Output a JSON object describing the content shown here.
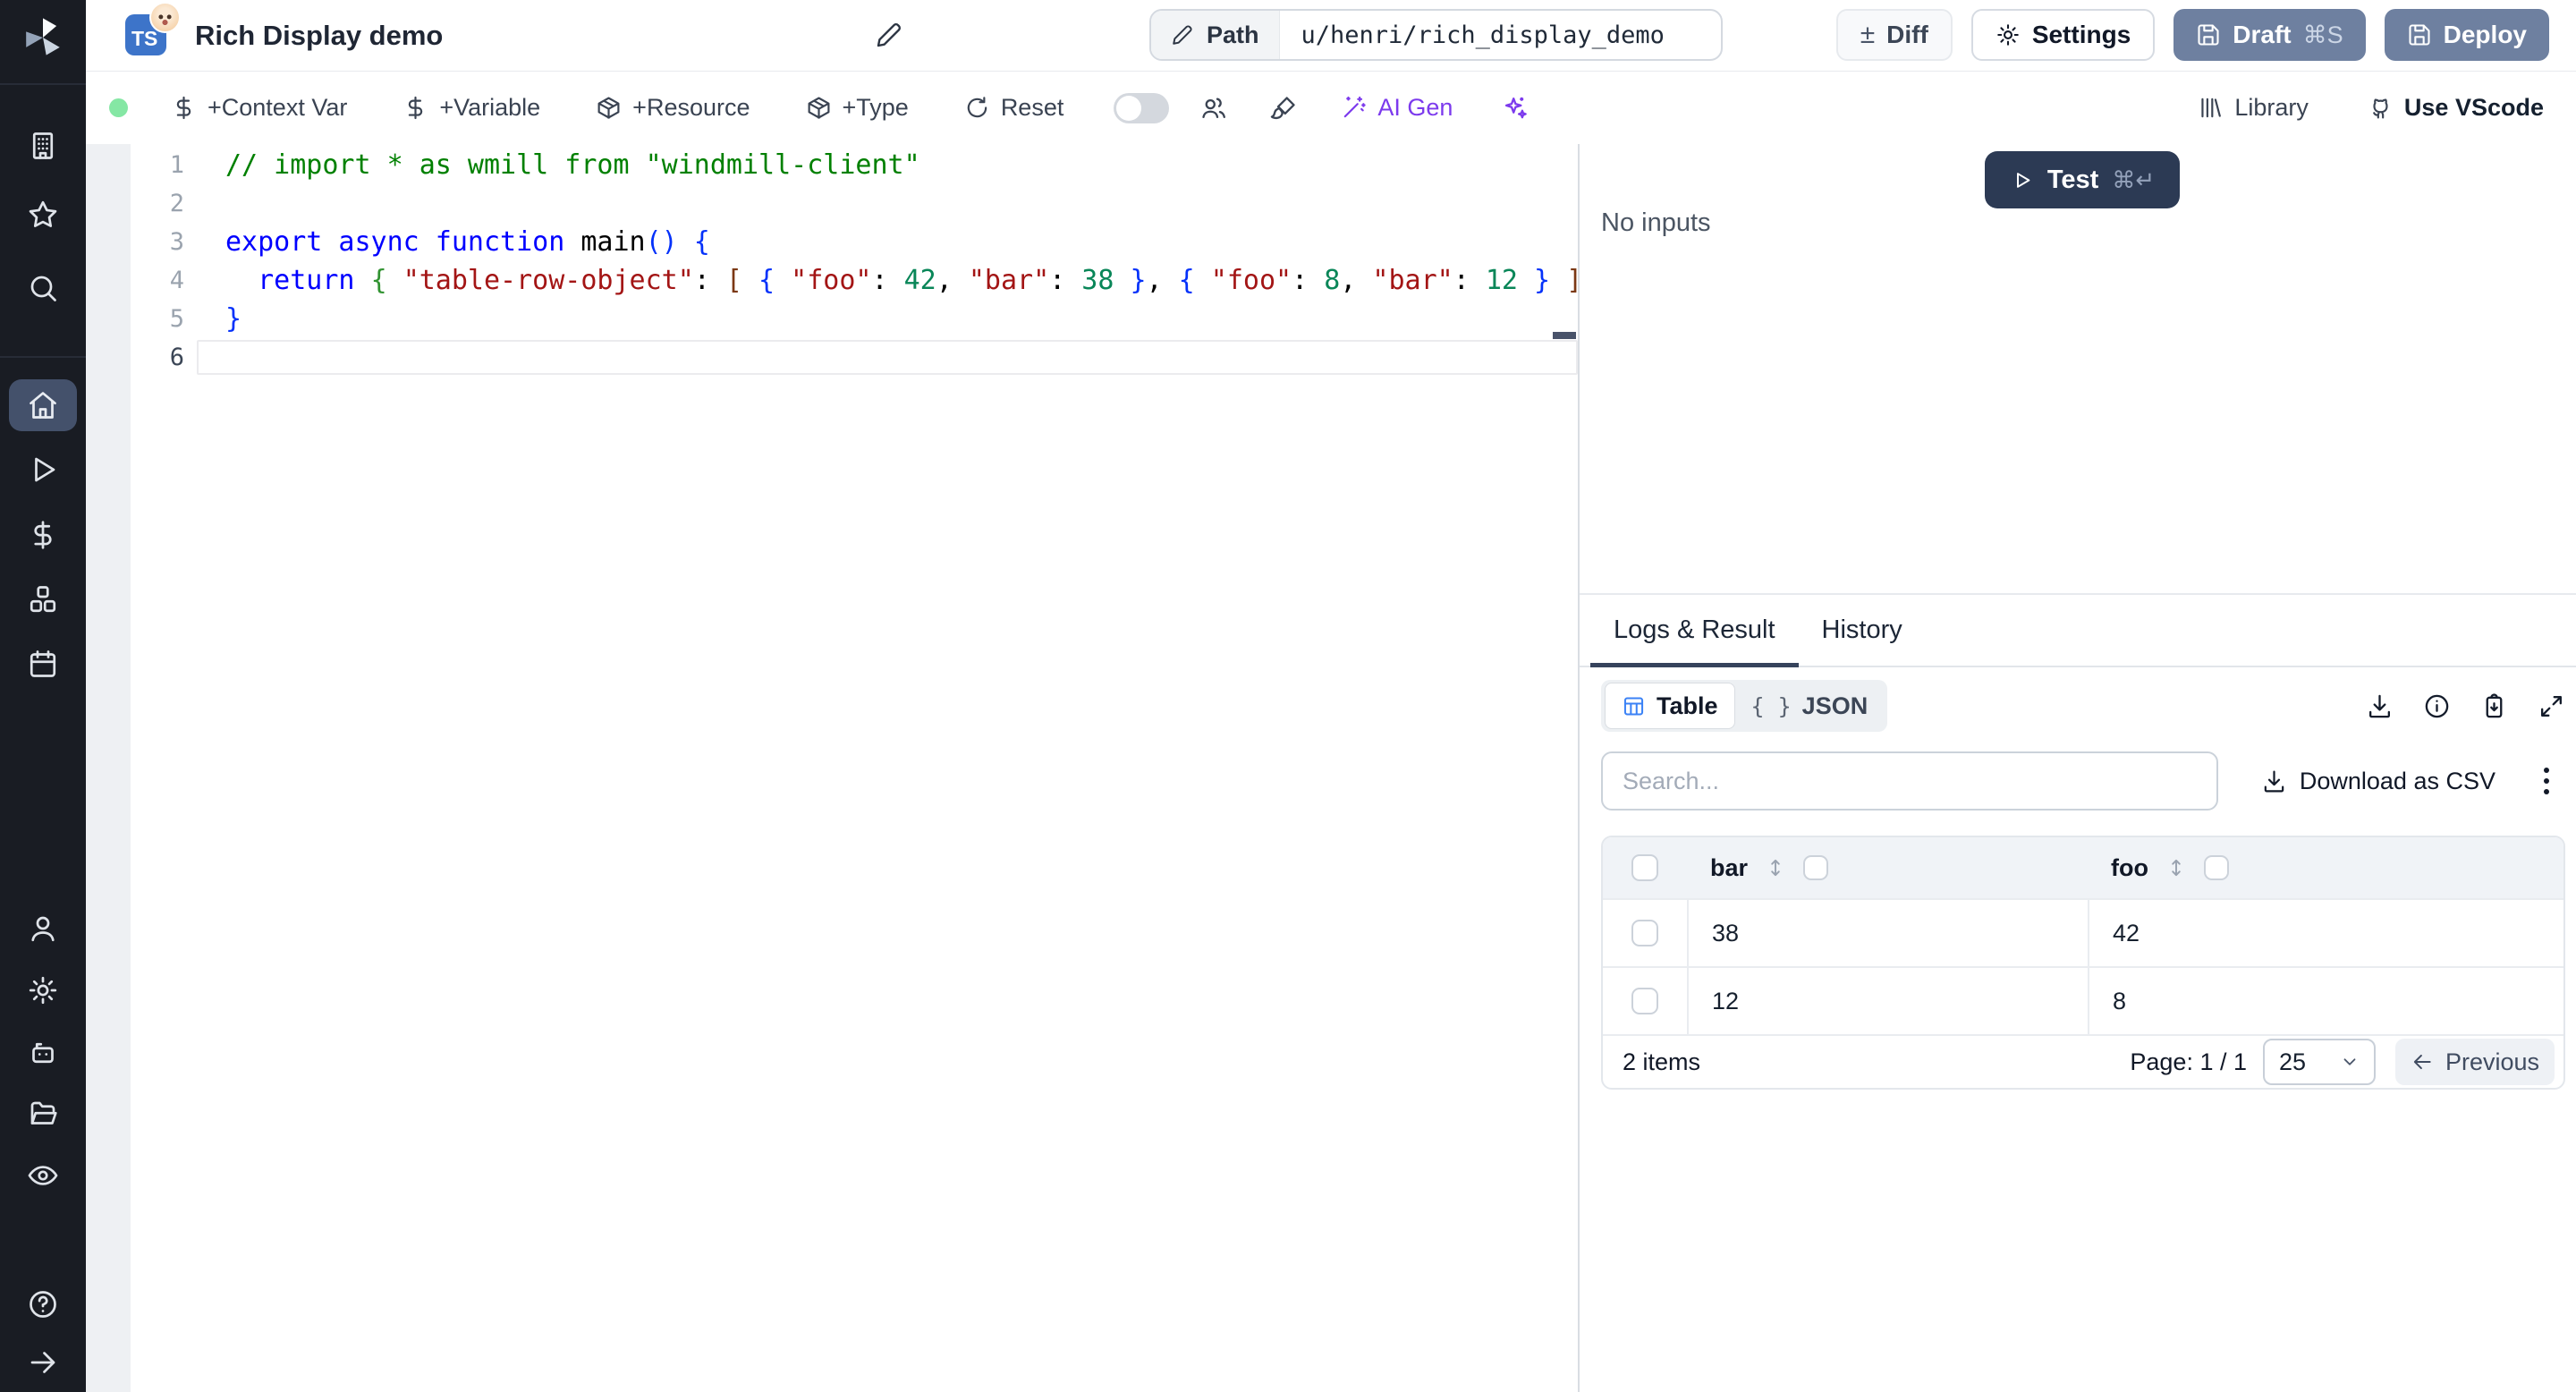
{
  "header": {
    "language_badge": "TS",
    "emoji_badge": "👶",
    "title": "Rich Display demo",
    "path_label": "Path",
    "path_value": "u/henri/rich_display_demo",
    "diff": "Diff",
    "settings": "Settings",
    "draft": "Draft",
    "draft_shortcut": "⌘S",
    "deploy": "Deploy"
  },
  "toolbar": {
    "context_var": "+Context Var",
    "variable": "+Variable",
    "resource": "+Resource",
    "type": "+Type",
    "reset": "Reset",
    "ai_gen": "AI Gen",
    "library": "Library",
    "vscode": "Use VScode"
  },
  "sidebar": {
    "items": [
      "windmill-logo",
      "workspace",
      "favorites",
      "search",
      "home",
      "runs",
      "variables",
      "resources",
      "schedules",
      "user",
      "settings",
      "workers",
      "folders",
      "audit-logs",
      "help",
      "expand-sidebar"
    ]
  },
  "editor": {
    "lines": [
      {
        "num": "1",
        "segments": [
          {
            "t": "// import * as wmill from \"windmill-client\"",
            "c": "cm"
          }
        ]
      },
      {
        "num": "2",
        "segments": []
      },
      {
        "num": "3",
        "segments": [
          {
            "t": "export async function ",
            "c": "kw"
          },
          {
            "t": "main",
            "c": "pl"
          },
          {
            "t": "()",
            "c": "b1"
          },
          {
            "t": " ",
            "c": "pl"
          },
          {
            "t": "{",
            "c": "b1"
          }
        ]
      },
      {
        "num": "4",
        "segments": [
          {
            "t": "  ",
            "c": "pl"
          },
          {
            "t": "return",
            "c": "kw"
          },
          {
            "t": " ",
            "c": "pl"
          },
          {
            "t": "{",
            "c": "b2"
          },
          {
            "t": " ",
            "c": "pl"
          },
          {
            "t": "\"table-row-object\"",
            "c": "s"
          },
          {
            "t": ": ",
            "c": "pl"
          },
          {
            "t": "[",
            "c": "b3"
          },
          {
            "t": " ",
            "c": "pl"
          },
          {
            "t": "{",
            "c": "b1"
          },
          {
            "t": " ",
            "c": "pl"
          },
          {
            "t": "\"foo\"",
            "c": "s"
          },
          {
            "t": ": ",
            "c": "pl"
          },
          {
            "t": "42",
            "c": "n"
          },
          {
            "t": ", ",
            "c": "pl"
          },
          {
            "t": "\"bar\"",
            "c": "s"
          },
          {
            "t": ": ",
            "c": "pl"
          },
          {
            "t": "38",
            "c": "n"
          },
          {
            "t": " ",
            "c": "pl"
          },
          {
            "t": "}",
            "c": "b1"
          },
          {
            "t": ", ",
            "c": "pl"
          },
          {
            "t": "{",
            "c": "b1"
          },
          {
            "t": " ",
            "c": "pl"
          },
          {
            "t": "\"foo\"",
            "c": "s"
          },
          {
            "t": ": ",
            "c": "pl"
          },
          {
            "t": "8",
            "c": "n"
          },
          {
            "t": ", ",
            "c": "pl"
          },
          {
            "t": "\"bar\"",
            "c": "s"
          },
          {
            "t": ": ",
            "c": "pl"
          },
          {
            "t": "12",
            "c": "n"
          },
          {
            "t": " ",
            "c": "pl"
          },
          {
            "t": "}",
            "c": "b1"
          },
          {
            "t": " ",
            "c": "pl"
          },
          {
            "t": "]",
            "c": "b3"
          },
          {
            "t": " ",
            "c": "pl"
          },
          {
            "t": "}",
            "c": "b2"
          }
        ]
      },
      {
        "num": "5",
        "segments": [
          {
            "t": "}",
            "c": "b1"
          }
        ]
      },
      {
        "num": "6",
        "segments": [],
        "active": true
      }
    ]
  },
  "run_panel": {
    "test": "Test",
    "test_shortcut": "⌘↵",
    "no_inputs": "No inputs"
  },
  "result_panel": {
    "tabs": {
      "logs_result": "Logs & Result",
      "history": "History"
    },
    "views": {
      "table": "Table",
      "json": "JSON"
    },
    "search_placeholder": "Search...",
    "download_csv": "Download as CSV",
    "table": {
      "columns": [
        "bar",
        "foo"
      ],
      "rows": [
        [
          "38",
          "42"
        ],
        [
          "12",
          "8"
        ]
      ],
      "items_count": "2 items",
      "page_label": "Page: 1 / 1",
      "page_size": "25",
      "previous": "Previous"
    }
  },
  "colors": {
    "accent_violet": "#7c3aed",
    "slate_button": "#6e80a0",
    "test_button": "#2c3a54",
    "status_green": "#85e7a4",
    "ts_badge_blue": "#3d74c9",
    "table_icon_blue": "#3b82f6",
    "sidebar_bg": "#191c23",
    "code": {
      "comment": "#008000",
      "keyword": "#0000ff",
      "string": "#a31515",
      "number": "#098658",
      "bracket1": "#0431fa",
      "bracket2": "#319331",
      "bracket3": "#7b3814"
    }
  }
}
